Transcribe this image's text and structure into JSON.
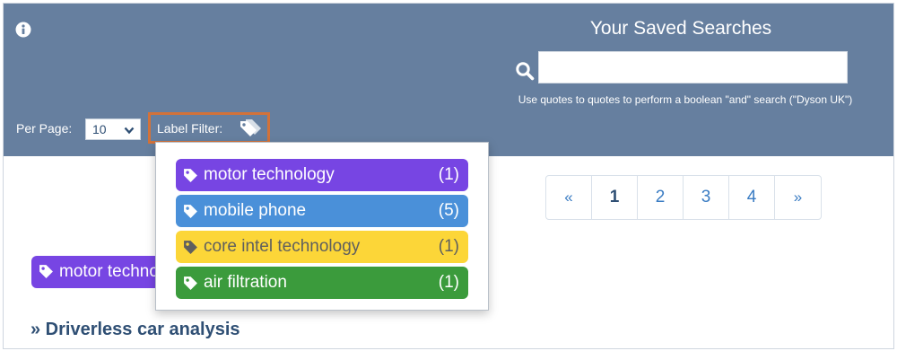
{
  "header": {
    "title": "Your Saved Searches",
    "search_value": "",
    "search_hint": "Use quotes to quotes to perform a boolean \"and\" search (\"Dyson UK\")",
    "icons": {
      "info": "info-circle-icon",
      "search": "search-icon"
    }
  },
  "controls": {
    "per_page_label": "Per Page:",
    "per_page_value": "10",
    "label_filter_label": "Label Filter:",
    "label_filter_icon": "tags-icon"
  },
  "label_dropdown": {
    "items": [
      {
        "label": "motor technology",
        "count": "(1)",
        "color": "#7745e3",
        "text_color": "#ffffff",
        "icon": "tag-icon"
      },
      {
        "label": "mobile phone",
        "count": "(5)",
        "color": "#4a90d9",
        "text_color": "#ffffff",
        "icon": "tag-icon"
      },
      {
        "label": "core intel technology",
        "count": "(1)",
        "color": "#fcd638",
        "text_color": "#5f5f5f",
        "icon": "tag-icon"
      },
      {
        "label": "air filtration",
        "count": "(1)",
        "color": "#3b9b3c",
        "text_color": "#ffffff",
        "icon": "tag-icon"
      }
    ]
  },
  "pagination": {
    "prev": "«",
    "pages": [
      "1",
      "2",
      "3",
      "4"
    ],
    "active": "1",
    "next": "»"
  },
  "results": {
    "background_tag": {
      "label": "motor technology",
      "color": "#7745e3"
    },
    "first_item_title": "» Driverless car analysis"
  },
  "colors": {
    "header_bg": "#667f9f",
    "filter_highlight": "#d2723a",
    "link": "#3a7cc3",
    "title_text": "#2f4f74"
  }
}
